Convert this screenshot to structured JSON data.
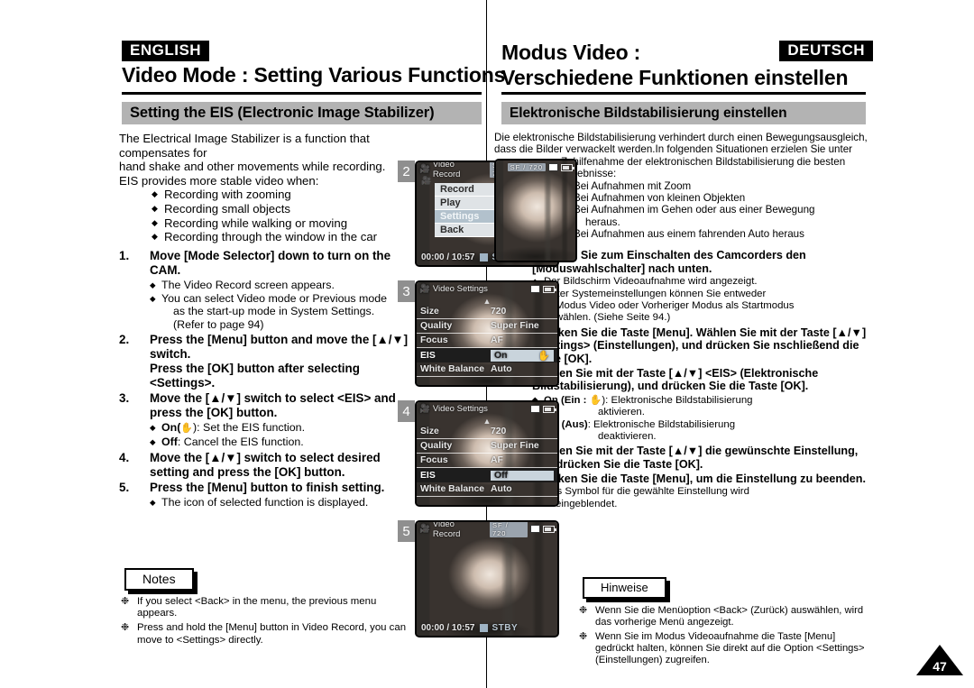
{
  "left": {
    "lang_tag": "ENGLISH",
    "page_title": "Video Mode : Setting Various Functions",
    "section_title": "Setting the EIS (Electronic Image Stabilizer)",
    "intro_line1": "The Electrical Image Stabilizer is a function that compensates for",
    "intro_line2": "hand shake and other movements while recording.",
    "intro_line3": "EIS provides more stable video when:",
    "intro_bullets": [
      "Recording with zooming",
      "Recording small objects",
      "Recording while walking or moving",
      "Recording through the window in the car"
    ],
    "steps": [
      {
        "num": "1.",
        "head": "Move [Mode Selector] down to turn on the CAM.",
        "subs": [
          {
            "text": "The Video Record screen appears."
          },
          {
            "text": "You can select Video mode or Previous mode",
            "cont": [
              "as the start-up mode in System Settings.",
              "(Refer to page 94)"
            ]
          }
        ]
      },
      {
        "num": "2.",
        "head": "Press the [Menu] button and move the [▲/▼] switch.",
        "head2": "Press the [OK] button after selecting <Settings>.",
        "subs": []
      },
      {
        "num": "3.",
        "head": "Move the [▲/▼] switch to select <EIS> and press the [OK] button.",
        "subs": [
          {
            "bold": "On(",
            "icon": "hand-icon",
            "text": "): Set the EIS function."
          },
          {
            "bold": "Off",
            "text": ": Cancel the EIS function."
          }
        ]
      },
      {
        "num": "4.",
        "head": "Move the [▲/▼] switch to select desired setting and press the [OK] button.",
        "subs": []
      },
      {
        "num": "5.",
        "head": "Press the [Menu] button to finish setting.",
        "subs": [
          {
            "text": "The icon of selected function is displayed."
          }
        ]
      }
    ],
    "notes_label": "Notes",
    "notes": [
      "If you select <Back> in the menu, the previous menu appears.",
      "Press and hold the [Menu] button in Video Record, you can move to <Settings> directly."
    ]
  },
  "right": {
    "lang_tag": "DEUTSCH",
    "page_title_line1": "Modus Video :",
    "page_title_line2": "Verschiedene Funktionen einstellen",
    "section_title": "Elektronische Bildstabilisierung einstellen",
    "intro_line1": "Die elektronische Bildstabilisierung verhindert durch einen Bewegungsausgleich,",
    "intro_line2": "dass die Bilder verwackelt werden.In folgenden Situationen erzielen Sie unter",
    "intro_line3": "Zuhilfenahme der elektronischen Bildstabilisierung die besten",
    "intro_line4": "Ergebnisse:",
    "intro_bullets": [
      "Bei Aufnahmen mit Zoom",
      "Bei Aufnahmen von kleinen Objekten",
      "Bei Aufnahmen im Gehen oder aus einer Bewegung",
      "Bei Aufnahmen aus einem fahrenden Auto heraus"
    ],
    "intro_bullet3_cont": "heraus.",
    "steps": [
      {
        "num": "1.",
        "head": "Drücken Sie zum Einschalten des Camcorders den [Moduswahlschalter] nach unten.",
        "subs": [
          {
            "text": "Der Bildschirm Videoaufnahme wird angezeigt."
          },
          {
            "text": "Unter Systemeinstellungen können Sie entweder",
            "cont": [
              "Modus Video oder Vorheriger Modus als Startmodus",
              "wählen. (Siehe Seite 94.)"
            ]
          }
        ]
      },
      {
        "num": "2.",
        "head": "Drücken Sie die Taste [Menu]. Wählen Sie mit der Taste [▲/▼] <Settings> (Einstellungen), und drücken Sie nschließend die Taste [OK].",
        "subs": []
      },
      {
        "num": "3.",
        "head": "Wählen Sie mit der Taste [▲/▼] <EIS> (Elektronische Bildstabilisierung), und drücken Sie die Taste [OK].",
        "subs": [
          {
            "bold": "On (Ein :",
            "icon": "hand-icon",
            "text": "): Elektronische Bildstabilisierung",
            "cont": [
              "aktivieren."
            ]
          },
          {
            "bold": "Off (Aus)",
            "text": ": Elektronische Bildstabilisierung",
            "cont": [
              "deaktivieren."
            ]
          }
        ]
      },
      {
        "num": "4.",
        "head": "Wählen Sie mit der Taste [▲/▼] die gewünschte Einstellung, und drücken Sie die Taste [OK].",
        "subs": []
      },
      {
        "num": "5.",
        "head": "Drücken Sie die Taste [Menu], um die Einstellung zu beenden.",
        "subs": [
          {
            "text": "Das Symbol für die gewählte Einstellung wird",
            "cont": [
              "eingeblendet."
            ]
          }
        ]
      }
    ],
    "notes_label": "Hinweise",
    "notes": [
      "Wenn Sie die Menüoption <Back> (Zurück) auswählen, wird das vorherige Menü angezeigt.",
      "Wenn Sie im Modus Videoaufnahme die Taste [Menu] gedrückt halten, können Sie direkt auf die Option <Settings> (Einstellungen) zugreifen."
    ]
  },
  "figures": [
    {
      "badge": "2",
      "osd_title": "Video Record",
      "osd_quality": "SF  /  720",
      "timecode": "00:00 / 10:57",
      "status": "STBY",
      "menu": [
        {
          "label": "Record",
          "selected": false
        },
        {
          "label": "Play",
          "selected": false
        },
        {
          "label": "Settings",
          "selected": true
        },
        {
          "label": "Back",
          "selected": false
        }
      ]
    },
    {
      "badge": "3",
      "osd_title": "Video Settings",
      "rows": [
        {
          "label": "Size",
          "value": "720",
          "highlight": false
        },
        {
          "label": "Quality",
          "value": "Super Fine",
          "highlight": false
        },
        {
          "label": "Focus",
          "value": "AF",
          "highlight": false
        },
        {
          "label": "EIS",
          "value": "On",
          "highlight": true,
          "icon": "hand-icon"
        },
        {
          "label": "White Balance",
          "value": "Auto",
          "highlight": false
        }
      ]
    },
    {
      "badge": "4",
      "osd_title": "Video Settings",
      "rows": [
        {
          "label": "Size",
          "value": "720",
          "highlight": false
        },
        {
          "label": "Quality",
          "value": "Super Fine",
          "highlight": false
        },
        {
          "label": "Focus",
          "value": "AF",
          "highlight": false
        },
        {
          "label": "EIS",
          "value": "Off",
          "highlight": true
        },
        {
          "label": "White Balance",
          "value": "Auto",
          "highlight": false
        }
      ]
    },
    {
      "badge": "5",
      "osd_title": "Video Record",
      "osd_quality": "SF  /  720",
      "timecode": "00:00 / 10:57",
      "status": "STBY"
    }
  ],
  "german_figure": {
    "osd_quality": "SF  /  720"
  },
  "page_number": "47"
}
